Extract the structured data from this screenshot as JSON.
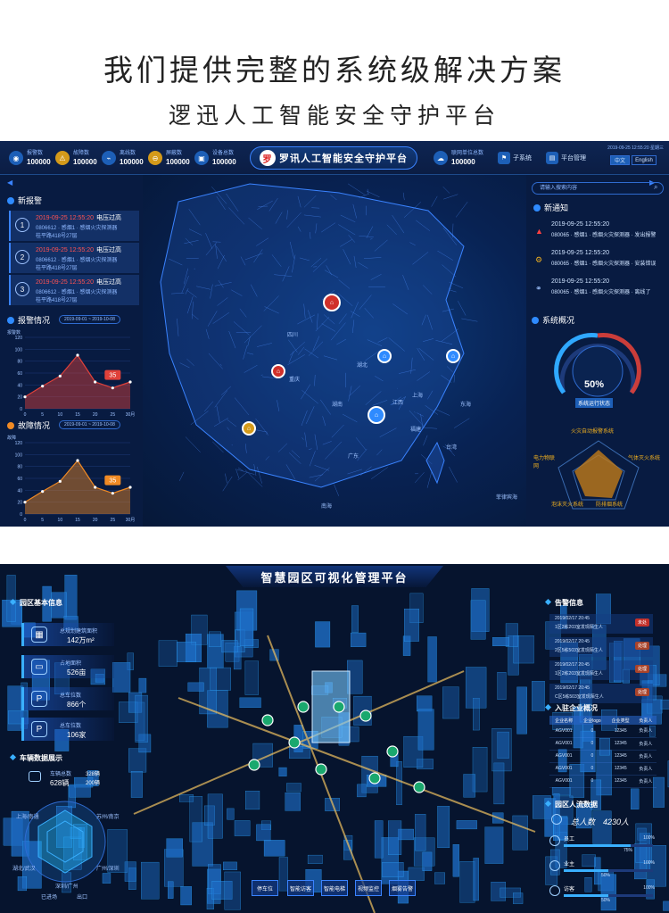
{
  "hero": {
    "title": "我们提供完整的系统级解决方案",
    "subtitle": "逻迅人工智能安全守护平台"
  },
  "panel1": {
    "stats": [
      {
        "label": "报警数",
        "value": "100000"
      },
      {
        "label": "故障数",
        "value": "100000"
      },
      {
        "label": "离线数",
        "value": "100000"
      },
      {
        "label": "屏蔽数",
        "value": "100000"
      },
      {
        "label": "设备总数",
        "value": "100000"
      },
      {
        "label": "联网单位总数",
        "value": "100000"
      }
    ],
    "title": "罗讯人工智能安全守护平台",
    "logo": "罗",
    "subsystem": "子系统",
    "platform": "平台管理",
    "datetime": "2019-09-25 12:55:20 星期三",
    "lang_cn": "中文",
    "lang_en": "English",
    "new_alarm": "新报警",
    "alarms": [
      {
        "no": "1",
        "time": "2019-09-25 12:55:20",
        "type": "电压过高",
        "line2": "0806612 · 感烟1 · 感烟火灾探测器",
        "line3": "桂平路418号27层"
      },
      {
        "no": "2",
        "time": "2019-09-25 12:55:20",
        "type": "电压过高",
        "line2": "0806612 · 感烟1 · 感烟火灾探测器",
        "line3": "桂平路418号27层"
      },
      {
        "no": "3",
        "time": "2019-09-25 12:55:20",
        "type": "电压过高",
        "line2": "0806612 · 感烟1 · 感烟火灾探测器",
        "line3": "桂平路418号27层"
      }
    ],
    "alarm_status": "报警情况",
    "fault_status": "故障情况",
    "range": "2019-09-01 ~ 2019-10-08",
    "chart_peak": "35",
    "search_placeholder": "请输入搜索内容",
    "new_notice": "新通知",
    "notices": [
      {
        "time": "2019-09-25 12:55:20",
        "text": "080065 · 感烟1 · 感烟火灾探测器 · 发出报警"
      },
      {
        "time": "2019-09-25 12:55:20",
        "text": "080065 · 感烟1 · 感烟火灾探测器 · 安装错误"
      },
      {
        "time": "2019-09-25 12:55:20",
        "text": "080065 · 感烟1 · 感烟火灾探测器 · 离线了"
      }
    ],
    "overview": "系统概况",
    "gauge_value": "50%",
    "gauge_label": "系统运行状态",
    "radar_labels": [
      "火灾自动报警系统",
      "气体灭火系统",
      "防排烟系统",
      "泡沫灭火系统",
      "电力物联网"
    ],
    "map_labels": [
      "四川",
      "重庆",
      "湖南",
      "湖北",
      "江西",
      "上海",
      "东海",
      "福建",
      "台湾",
      "广东",
      "南海",
      "菲律宾海"
    ]
  },
  "chart_data": [
    {
      "type": "area",
      "title": "报警情况",
      "ylabel": "报警数",
      "x": [
        0,
        5,
        10,
        15,
        20,
        25,
        30
      ],
      "xlabel": "月",
      "values": [
        20,
        38,
        55,
        90,
        45,
        35,
        45
      ],
      "ylim": [
        0,
        120
      ],
      "tick_labels": [
        "0",
        "5",
        "10",
        "15",
        "20",
        "25",
        "30月"
      ],
      "y_ticks": [
        "0",
        "20",
        "40",
        "60",
        "80",
        "100",
        "120"
      ],
      "color": "#e0413a"
    },
    {
      "type": "area",
      "title": "故障情况",
      "ylabel": "故障",
      "x": [
        0,
        5,
        10,
        15,
        20,
        25,
        30
      ],
      "xlabel": "月",
      "values": [
        20,
        38,
        55,
        90,
        45,
        35,
        45
      ],
      "ylim": [
        0,
        120
      ],
      "tick_labels": [
        "0",
        "5",
        "10",
        "15",
        "20",
        "25",
        "30月"
      ],
      "y_ticks": [
        "0",
        "20",
        "40",
        "60",
        "80",
        "100",
        "120"
      ],
      "color": "#f08a24"
    }
  ],
  "panel2": {
    "title": "智慧园区可视化管理平台",
    "basic_info": "园区基本信息",
    "kpis": [
      {
        "label": "总规划建筑面积",
        "value": "142万m²"
      },
      {
        "label": "占地面积",
        "value": "526亩"
      },
      {
        "label": "总车位数",
        "value": "866个"
      },
      {
        "label": "总车位数",
        "value": "106家"
      }
    ],
    "vehicle": "车辆数据展示",
    "vehicle_total_label": "车辆总数",
    "vehicle_total": "628辆",
    "vehicle_in": "328辆",
    "vehicle_out": "200辆",
    "radar2_labels": [
      "上海/南通",
      "苏州/南京",
      "深圳/广州",
      "湖北/武汉",
      "广州/深圳"
    ],
    "legend": [
      "已进场",
      "出口"
    ],
    "warning": "告警信息",
    "warnings": [
      {
        "time": "2019/02/17 20:45",
        "text": "1区2栋203室发现陌生人",
        "tag": "未处"
      },
      {
        "time": "2019/02/17 20:45",
        "text": "2区5栋503室发现陌生人",
        "tag": "处理"
      },
      {
        "time": "2019/02/17 20:45",
        "text": "1区2栋203室发现陌生人",
        "tag": "处理"
      },
      {
        "time": "2019/02/17 20:45",
        "text": "C区5栋503室发现陌生人",
        "tag": "处理"
      }
    ],
    "company": "入驻企业概况",
    "table_headers": [
      "企业名称",
      "企业logo",
      "企业类型",
      "负责人"
    ],
    "table_rows": [
      [
        "AGV001",
        "0",
        "12345",
        "负责人"
      ],
      [
        "AGV001",
        "0",
        "12345",
        "负责人"
      ],
      [
        "AGV001",
        "0",
        "12345",
        "负责人"
      ],
      [
        "AGV001",
        "0",
        "12345",
        "负责人"
      ],
      [
        "AGV001",
        "0",
        "12345",
        "负责人"
      ]
    ],
    "people": "园区人流数据",
    "people_total_label": "总人数",
    "people_total": "4230人",
    "flows": [
      {
        "name": "员工",
        "pct": "100%",
        "pct2": "75%",
        "value": 0.75
      },
      {
        "name": "业主",
        "pct": "100%",
        "pct2": "50%",
        "value": 0.5
      },
      {
        "name": "访客",
        "pct": "100%",
        "pct2": "50%",
        "value": 0.5
      }
    ],
    "bottom_buttons": [
      "停车位",
      "智能访客",
      "智能电梯",
      "视频监控",
      "烟雾告警"
    ]
  }
}
